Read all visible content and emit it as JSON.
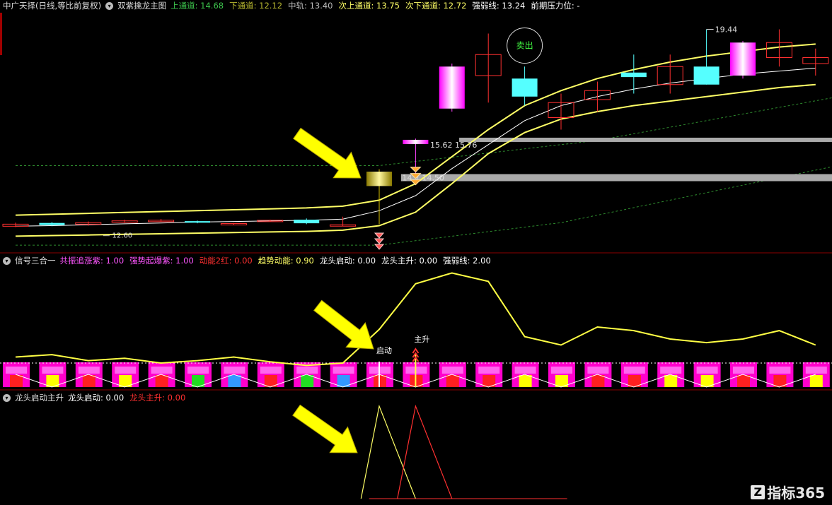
{
  "panel1": {
    "title": "中广天择(日线,等比前复权)",
    "indicator": "双紫擒龙主图",
    "fields": [
      {
        "label": "上通道:",
        "value": "14.68",
        "color": "#3cc34c"
      },
      {
        "label": "下通道:",
        "value": "12.12",
        "color": "#b9b930"
      },
      {
        "label": "中轨:",
        "value": "13.40",
        "color": "#bbbbbb"
      },
      {
        "label": "次上通道:",
        "value": "13.75",
        "color": "#ffff66"
      },
      {
        "label": "次下通道:",
        "value": "12.72",
        "color": "#ffff66"
      },
      {
        "label": "强弱线:",
        "value": "13.24",
        "color": "#ffffff"
      },
      {
        "label": "前期压力位:",
        "value": "-",
        "color": "#ffffff"
      }
    ],
    "annotations": {
      "high_price": "19.44",
      "low_price": "12.60",
      "price_a": "15.62",
      "price_b": "15.76",
      "price_c": "14.7",
      "price_d": "14.50",
      "sell_label": "卖出"
    }
  },
  "panel2": {
    "title": "信号三合一",
    "fields": [
      {
        "label": "共振追涨紫:",
        "value": "1.00",
        "color": "#ff55ff"
      },
      {
        "label": "强势起爆紫:",
        "value": "1.00",
        "color": "#ff55ff"
      },
      {
        "label": "动能2红:",
        "value": "0.00",
        "color": "#ff3030"
      },
      {
        "label": "趋势动能:",
        "value": "0.90",
        "color": "#ffff66"
      },
      {
        "label": "龙头启动:",
        "value": "0.00",
        "color": "#ffffff"
      },
      {
        "label": "龙头主升:",
        "value": "0.00",
        "color": "#ffffff"
      },
      {
        "label": "强弱线:",
        "value": "2.00",
        "color": "#ffffff"
      }
    ],
    "start_label": "启动",
    "rise_label": "主升"
  },
  "panel3": {
    "title": "龙头启动主升",
    "fields": [
      {
        "label": "龙头启动:",
        "value": "0.00",
        "color": "#ffffff"
      },
      {
        "label": "龙头主升:",
        "value": "0.00",
        "color": "#ff3030"
      }
    ]
  },
  "watermark": "指标365",
  "chart_data": [
    {
      "type": "candlestick",
      "name": "双紫擒龙主图",
      "candles": [
        {
          "o": 12.95,
          "c": 12.88,
          "h": 13.0,
          "l": 12.85,
          "color": "red"
        },
        {
          "o": 12.92,
          "c": 12.99,
          "h": 13.02,
          "l": 12.88,
          "color": "cyan"
        },
        {
          "o": 13.0,
          "c": 12.95,
          "h": 13.04,
          "l": 12.9,
          "color": "red"
        },
        {
          "o": 13.03,
          "c": 13.06,
          "h": 13.1,
          "l": 12.99,
          "color": "red"
        },
        {
          "o": 13.05,
          "c": 13.08,
          "h": 13.12,
          "l": 13.03,
          "color": "red"
        },
        {
          "o": 13.05,
          "c": 13.0,
          "h": 13.07,
          "l": 12.98,
          "color": "cyan"
        },
        {
          "o": 12.95,
          "c": 12.97,
          "h": 12.99,
          "l": 12.93,
          "color": "red"
        },
        {
          "o": 13.06,
          "c": 13.08,
          "h": 13.1,
          "l": 13.04,
          "color": "red"
        },
        {
          "o": 13.1,
          "c": 12.98,
          "h": 13.14,
          "l": 12.95,
          "color": "cyan"
        },
        {
          "o": 12.9,
          "c": 12.93,
          "h": 13.2,
          "l": 12.88,
          "color": "red"
        },
        {
          "o": 14.22,
          "c": 14.7,
          "h": 14.78,
          "l": 12.95,
          "color": "gold"
        },
        {
          "o": 15.62,
          "c": 15.76,
          "h": 15.8,
          "l": 14.5,
          "color": "magenta"
        },
        {
          "o": 16.8,
          "c": 18.2,
          "h": 18.3,
          "l": 16.7,
          "color": "magenta"
        },
        {
          "o": 17.9,
          "c": 18.6,
          "h": 19.3,
          "l": 17.0,
          "color": "red"
        },
        {
          "o": 17.8,
          "c": 17.2,
          "h": 18.2,
          "l": 16.9,
          "color": "cyan"
        },
        {
          "o": 16.5,
          "c": 17.0,
          "h": 17.3,
          "l": 16.1,
          "color": "red"
        },
        {
          "o": 17.1,
          "c": 17.4,
          "h": 17.7,
          "l": 16.7,
          "color": "red"
        },
        {
          "o": 18.0,
          "c": 17.85,
          "h": 18.6,
          "l": 17.3,
          "color": "cyan"
        },
        {
          "o": 17.6,
          "c": 18.2,
          "h": 18.6,
          "l": 17.3,
          "color": "red"
        },
        {
          "o": 17.6,
          "c": 18.2,
          "h": 19.44,
          "l": 17.6,
          "color": "cyan"
        },
        {
          "o": 17.9,
          "c": 19.0,
          "h": 19.05,
          "l": 17.8,
          "color": "magenta"
        },
        {
          "o": 18.5,
          "c": 19.0,
          "h": 19.44,
          "l": 18.2,
          "color": "red"
        },
        {
          "o": 18.3,
          "c": 18.5,
          "h": 18.8,
          "l": 17.9,
          "color": "red"
        }
      ],
      "upper_channel": [
        13.25,
        13.28,
        13.31,
        13.34,
        13.37,
        13.4,
        13.43,
        13.46,
        13.49,
        13.55,
        13.75,
        14.3,
        15.2,
        16.1,
        16.9,
        17.4,
        17.8,
        18.1,
        18.35,
        18.55,
        18.7,
        18.85,
        18.95
      ],
      "lower_channel": [
        12.55,
        12.57,
        12.59,
        12.61,
        12.63,
        12.65,
        12.67,
        12.69,
        12.71,
        12.75,
        12.9,
        13.35,
        14.3,
        15.3,
        16.0,
        16.45,
        16.7,
        16.9,
        17.05,
        17.2,
        17.35,
        17.5,
        17.6
      ],
      "middle_line": [
        12.88,
        12.9,
        12.93,
        12.96,
        12.99,
        13.02,
        13.04,
        13.06,
        13.08,
        13.12,
        13.4,
        13.9,
        14.8,
        15.6,
        16.4,
        16.9,
        17.2,
        17.45,
        17.65,
        17.8,
        17.95,
        18.05,
        18.15
      ],
      "resistance_levels": [
        15.76,
        14.5
      ],
      "sell_signal_index": 14
    },
    {
      "type": "line",
      "name": "信号三合一 趋势动能",
      "values": [
        0.25,
        0.27,
        0.22,
        0.24,
        0.2,
        0.22,
        0.25,
        0.21,
        0.18,
        0.2,
        0.48,
        0.86,
        0.95,
        0.88,
        0.42,
        0.35,
        0.5,
        0.47,
        0.4,
        0.37,
        0.4,
        0.47,
        0.35
      ],
      "signal_labels": [
        {
          "index": 10,
          "text": "启动"
        },
        {
          "index": 11,
          "text": "主升"
        }
      ]
    },
    {
      "type": "line",
      "name": "龙头启动主升",
      "series": [
        {
          "name": "龙头启动",
          "color": "#ffff66",
          "points": [
            [
              9.5,
              0
            ],
            [
              10,
              1
            ],
            [
              11,
              0
            ]
          ]
        },
        {
          "name": "龙头主升",
          "color": "#ff3030",
          "points": [
            [
              10.5,
              0
            ],
            [
              11,
              1
            ],
            [
              12,
              0
            ]
          ]
        }
      ]
    }
  ]
}
